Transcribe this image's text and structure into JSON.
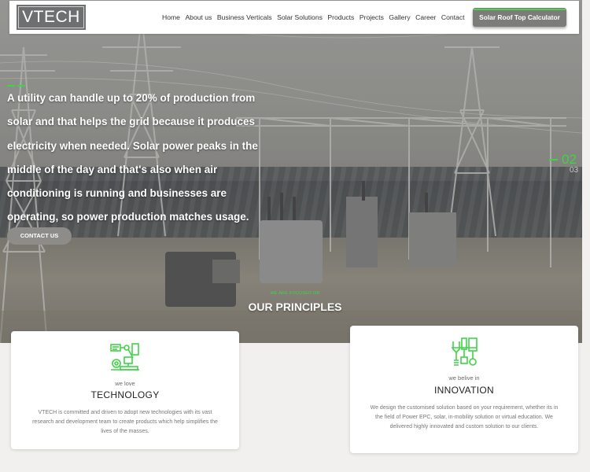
{
  "brand": {
    "logo_text": "VTECH"
  },
  "nav": {
    "items": [
      "Home",
      "About us",
      "Business Verticals",
      "Solar Solutions",
      "Products",
      "Projects",
      "Gallery",
      "Career",
      "Contact"
    ],
    "cta_label": "Solar Roof Top Calculator"
  },
  "hero": {
    "text": "A utility can handle up to 20% of production from solar and that helps the grid because it produces electricity when needed. Solar power peaks in the middle of the day and that's also when air conditioning is running and businesses are operating, so power production matches usage.",
    "contact_label": "CONTACT US",
    "slide_current": "02",
    "slide_next": "03"
  },
  "principles": {
    "eyebrow": "WE ARE FOCUSED ON",
    "title": "OUR PRINCIPLES"
  },
  "cards": [
    {
      "icon": "robot-arm-icon",
      "sub": "we love",
      "title": "TECHNOLOGY",
      "desc": "VTECH is committed and driven to adopt new technologies with its vast research and development team to create products which help simplifies the lives of the masses."
    },
    {
      "icon": "tools-icon",
      "sub": "we belive in",
      "title": "INNOVATION",
      "desc": "We design the customised solution based on your requirement, whether its in the field of Power EPC, solar, in-mobility solution or virtual education. We delivered highly innovated and custom solution to our clients."
    }
  ],
  "colors": {
    "accent": "#3fd447",
    "nav_bg": "#ffffff",
    "button_bg": "#7c7c7a"
  }
}
